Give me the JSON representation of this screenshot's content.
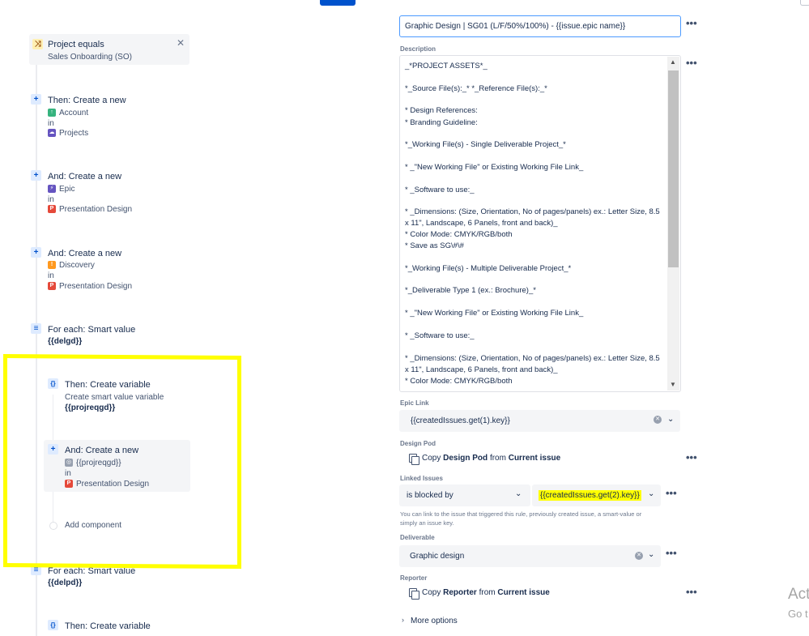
{
  "rule": {
    "condition": {
      "title": "Project equals",
      "subtitle": "Sales Onboarding (SO)"
    },
    "step1": {
      "title": "Then: Create a new",
      "type": "Account",
      "in": "in",
      "project": "Projects"
    },
    "step2": {
      "title": "And: Create a new",
      "type": "Epic",
      "in": "in",
      "project": "Presentation Design"
    },
    "step3": {
      "title": "And: Create a new",
      "type": "Discovery",
      "in": "in",
      "project": "Presentation Design"
    },
    "foreach1": {
      "title": "For each: Smart value",
      "value": "{{delgd}}"
    },
    "var1": {
      "title": "Then: Create variable",
      "subtitle": "Create smart value variable",
      "value": "{{projreqgd}}"
    },
    "step4": {
      "title": "And: Create a new",
      "type": "{{projreqgd}}",
      "in": "in",
      "project": "Presentation Design"
    },
    "add_component": "Add component",
    "foreach2": {
      "title": "For each: Smart value",
      "value": "{{delpd}}"
    },
    "var2": {
      "title": "Then: Create variable"
    }
  },
  "form": {
    "summary_value": "Graphic Design | SG01 (L/F/50%/100%) - {{issue.epic name}}",
    "description_label": "Description",
    "description_lines": [
      "_*PROJECT ASSETS*_",
      "*_Source File(s):_* *_Reference File(s):_*",
      "* Design References:",
      "* Branding Guideline:",
      "*_Working File(s) - Single Deliverable Project_*",
      "* _\"New Working File\" or Existing Working File Link_",
      "* _Software to use:_",
      "* _Dimensions: (Size, Orientation, No of pages/panels) ex.: Letter Size, 8.5",
      "x 11\", Landscape, 6 Panels, front and back)_",
      "* Color Mode: CMYK/RGB/both",
      "* Save as SG\\#\\#",
      "*_Working File(s) - Multiple Deliverable Project_*",
      "*_Deliverable Type 1 (ex.: Brochure)_*",
      "* _\"New Working File\" or Existing Working File Link_",
      "* _Software to use:_",
      "* _Dimensions: (Size, Orientation, No of pages/panels) ex.: Letter Size, 8.5",
      "x 11\", Landscape, 6 Panels, front and back)_",
      "* Color Mode: CMYK/RGB/both"
    ],
    "epic_link_label": "Epic Link",
    "epic_link_value": "{{createdIssues.get(1).key}}",
    "design_pod_label": "Design Pod",
    "design_pod_copy": "Copy",
    "design_pod_field": "Design Pod",
    "design_pod_from": "from",
    "design_pod_source": "Current issue",
    "linked_issues_label": "Linked Issues",
    "linked_relation": "is blocked by",
    "linked_value": "{{createdIssues.get(2).key}}",
    "linked_help_1": "You can link to the issue that triggered this rule, previously created issue, a smart-value or",
    "linked_help_2": "simply an issue key.",
    "deliverable_label": "Deliverable",
    "deliverable_value": "Graphic design",
    "reporter_label": "Reporter",
    "reporter_copy": "Copy",
    "reporter_field": "Reporter",
    "reporter_from": "from",
    "reporter_source": "Current issue",
    "more_options": "More options"
  },
  "watermark": {
    "line1": "Act",
    "line2": "Go t"
  }
}
